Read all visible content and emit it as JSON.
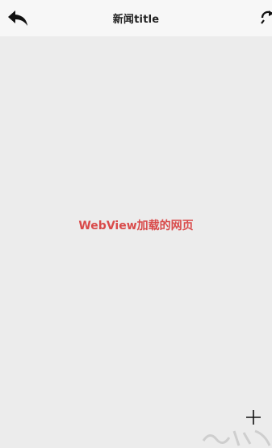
{
  "header": {
    "title": "新闻title"
  },
  "webview": {
    "label": "WebView加载的网页"
  },
  "icons": {
    "back": "back-arrow-icon",
    "refresh": "refresh-icon",
    "plus": "plus-icon"
  },
  "colors": {
    "header_bg": "#f7f7f7",
    "page_bg": "#ececec",
    "accent_red": "#d94a4a"
  }
}
